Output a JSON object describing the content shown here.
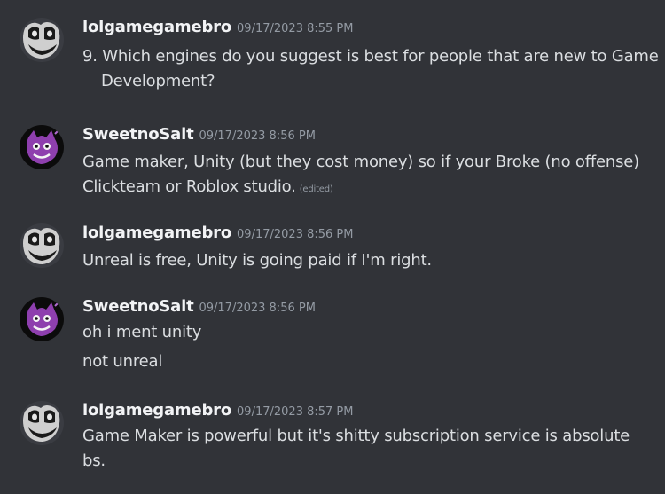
{
  "messages": [
    {
      "author": "lolgamegamebro",
      "timestamp": "09/17/2023 8:55 PM",
      "lines": [
        "9. Which engines do you suggest is best for people that are new to Game",
        "Development?"
      ]
    },
    {
      "author": "SweetnoSalt",
      "timestamp": "09/17/2023 8:56 PM",
      "lines": [
        "Game maker, Unity (but they cost money) so if your Broke (no offense)",
        "Clickteam or Roblox studio."
      ],
      "edited": "(edited)"
    },
    {
      "author": "lolgamegamebro",
      "timestamp": "09/17/2023 8:56 PM",
      "lines": [
        "Unreal is free, Unity is going paid if I'm right."
      ]
    },
    {
      "author": "SweetnoSalt",
      "timestamp": "09/17/2023 8:56 PM",
      "lines": [
        "oh i ment unity"
      ]
    },
    {
      "lines": [
        "not unreal"
      ]
    },
    {
      "author": "lolgamegamebro",
      "timestamp": "09/17/2023 8:57 PM",
      "lines": [
        "Game Maker is powerful but it's shitty subscription service is absolute",
        "bs."
      ]
    }
  ]
}
